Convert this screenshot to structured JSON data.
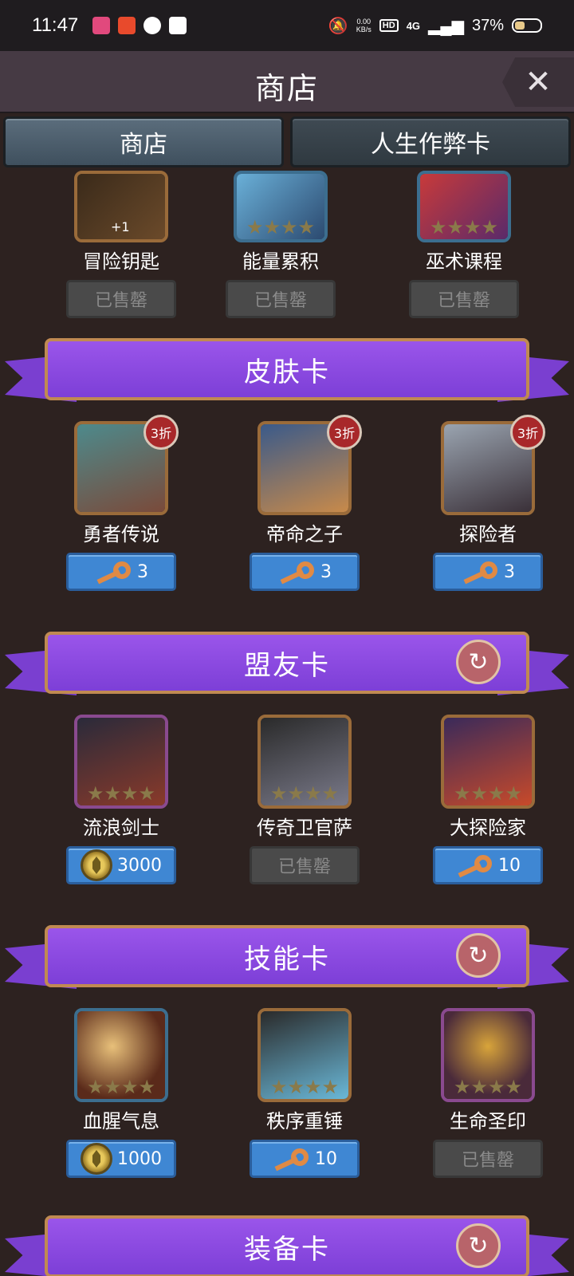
{
  "status": {
    "time": "11:47",
    "net_speed": "0.00",
    "net_unit": "KB/s",
    "hd": "HD",
    "signal": "4G",
    "battery": "37%"
  },
  "header": {
    "title": "商店",
    "close": "✕"
  },
  "tabs": [
    {
      "label": "商店",
      "active": true
    },
    {
      "label": "人生作弊卡",
      "active": false
    }
  ],
  "top_items": [
    {
      "name": "冒险钥匙",
      "price": "已售罄",
      "badge": "+1"
    },
    {
      "name": "能量累积",
      "price": "已售罄"
    },
    {
      "name": "巫术课程",
      "price": "已售罄"
    }
  ],
  "sections": {
    "skin": {
      "title": "皮肤卡",
      "items": [
        {
          "name": "勇者传说",
          "discount": "3折",
          "cost": "3",
          "currency": "key"
        },
        {
          "name": "帝命之子",
          "discount": "3折",
          "cost": "3",
          "currency": "key"
        },
        {
          "name": "探险者",
          "discount": "3折",
          "cost": "3",
          "currency": "key"
        }
      ]
    },
    "ally": {
      "title": "盟友卡",
      "items": [
        {
          "name": "流浪剑士",
          "cost": "3000",
          "currency": "coin"
        },
        {
          "name": "传奇卫官萨",
          "price": "已售罄"
        },
        {
          "name": "大探险家",
          "cost": "10",
          "currency": "key"
        }
      ]
    },
    "skill": {
      "title": "技能卡",
      "items": [
        {
          "name": "血腥气息",
          "cost": "1000",
          "currency": "coin"
        },
        {
          "name": "秩序重锤",
          "cost": "10",
          "currency": "key"
        },
        {
          "name": "生命圣印",
          "price": "已售罄"
        }
      ]
    },
    "equip": {
      "title": "装备卡"
    }
  },
  "colors": {
    "banner": "#8a48e0",
    "buy": "#3f87d3",
    "sold": "#4a4a4a",
    "discount": "#a8282a"
  }
}
